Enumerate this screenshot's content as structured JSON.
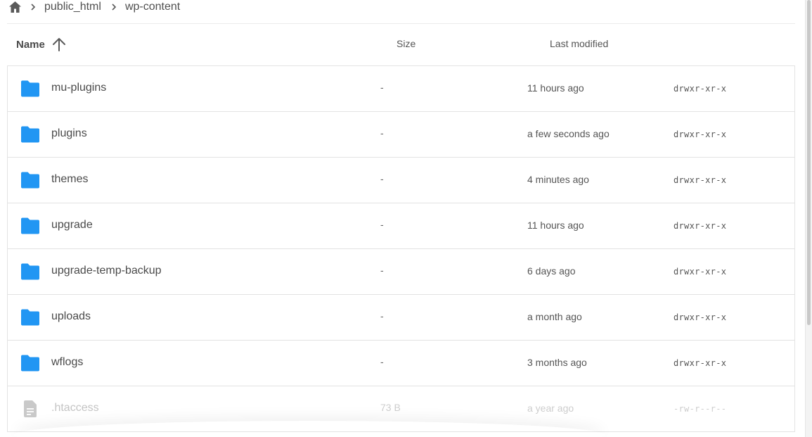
{
  "breadcrumb": {
    "items": [
      "public_html",
      "wp-content"
    ]
  },
  "header": {
    "name_label": "Name",
    "size_label": "Size",
    "modified_label": "Last modified",
    "sort": "ascending"
  },
  "colors": {
    "folder": "#2196f3",
    "file": "#c9c9c9"
  },
  "rows": [
    {
      "type": "folder",
      "name": "mu-plugins",
      "size": "-",
      "modified": "11 hours ago",
      "perms": "drwxr-xr-x"
    },
    {
      "type": "folder",
      "name": "plugins",
      "size": "-",
      "modified": "a few seconds ago",
      "perms": "drwxr-xr-x"
    },
    {
      "type": "folder",
      "name": "themes",
      "size": "-",
      "modified": "4 minutes ago",
      "perms": "drwxr-xr-x"
    },
    {
      "type": "folder",
      "name": "upgrade",
      "size": "-",
      "modified": "11 hours ago",
      "perms": "drwxr-xr-x"
    },
    {
      "type": "folder",
      "name": "upgrade-temp-backup",
      "size": "-",
      "modified": "6 days ago",
      "perms": "drwxr-xr-x"
    },
    {
      "type": "folder",
      "name": "uploads",
      "size": "-",
      "modified": "a month ago",
      "perms": "drwxr-xr-x"
    },
    {
      "type": "folder",
      "name": "wflogs",
      "size": "-",
      "modified": "3 months ago",
      "perms": "drwxr-xr-x"
    },
    {
      "type": "file",
      "name": ".htaccess",
      "size": "73 B",
      "modified": "a year ago",
      "perms": "-rw-r--r--"
    }
  ]
}
